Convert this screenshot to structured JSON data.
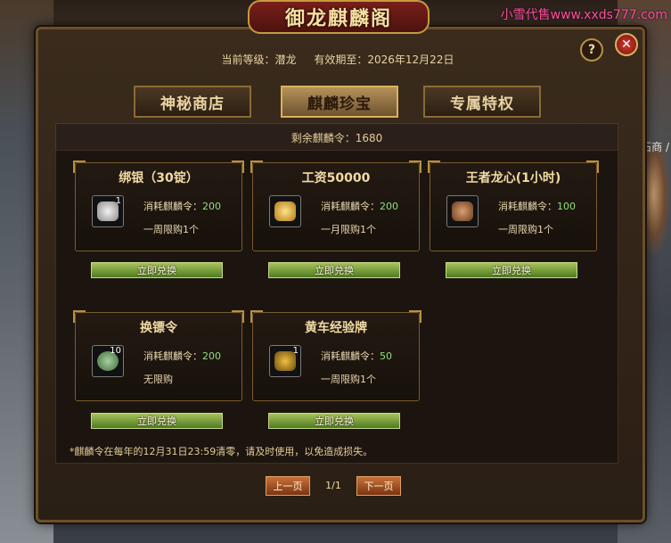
{
  "watermark": "小雪代售www.xxds777.com",
  "window": {
    "title": "御龙麒麟阁"
  },
  "side_label": "石商 /",
  "level": {
    "current": "当前等级：潜龙",
    "expiry": "有效期至：2026年12月22日"
  },
  "tabs": [
    {
      "label": "神秘商店",
      "active": false
    },
    {
      "label": "麒麟珍宝",
      "active": true
    },
    {
      "label": "专属特权",
      "active": false
    }
  ],
  "remaining": "剩余麒麟令：1680",
  "items": [
    {
      "title": "绑银（30锭）",
      "cost_label": "消耗麒麟令：",
      "cost": "200",
      "limit": "一周限购1个",
      "qty": "1",
      "icon": "silver-ingot-icon"
    },
    {
      "title": "工资50000",
      "cost_label": "消耗麒麟令：",
      "cost": "200",
      "limit": "一月限购1个",
      "qty": "",
      "icon": "gold-ingot-icon"
    },
    {
      "title": "王者龙心(1小时)",
      "cost_label": "消耗麒麟令：",
      "cost": "100",
      "limit": "一周限购1个",
      "qty": "",
      "icon": "dragon-heart-icon"
    },
    {
      "title": "换镖令",
      "cost_label": "消耗麒麟令：",
      "cost": "200",
      "limit": "无限购",
      "qty": "10",
      "icon": "exchange-token-icon"
    },
    {
      "title": "黄车经验牌",
      "cost_label": "消耗麒麟令：",
      "cost": "50",
      "limit": "一周限购1个",
      "qty": "1",
      "icon": "yellow-cart-icon"
    }
  ],
  "redeem_label": "立即兑换",
  "note": "*麒麟令在每年的12月31日23:59清零，请及时使用，以免造成损失。",
  "pager": {
    "prev": "上一页",
    "page": "1/1",
    "next": "下一页"
  },
  "colors": {
    "accent": "#d9b25a",
    "green_button": "#6f9a30",
    "cost_value": "#8fe07a"
  }
}
